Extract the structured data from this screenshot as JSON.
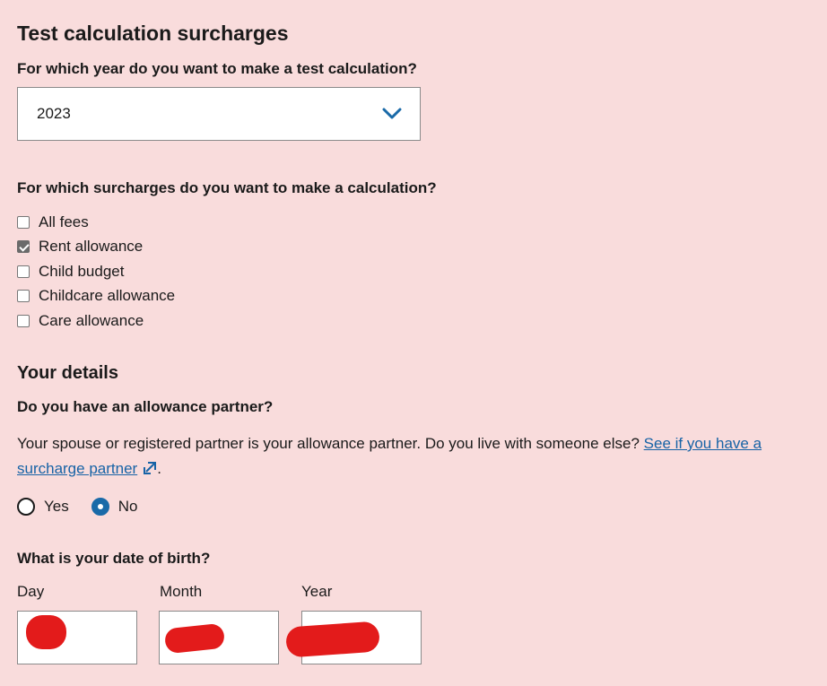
{
  "page": {
    "title": "Test calculation surcharges"
  },
  "year_question": {
    "label": "For which year do you want to make a test calculation?",
    "selected_value": "2023"
  },
  "surcharges_question": {
    "label": "For which surcharges do you want to make a calculation?",
    "options": [
      {
        "label": "All fees",
        "checked": false
      },
      {
        "label": "Rent allowance",
        "checked": true
      },
      {
        "label": "Child budget",
        "checked": false
      },
      {
        "label": "Childcare allowance",
        "checked": false
      },
      {
        "label": "Care allowance",
        "checked": false
      }
    ]
  },
  "details": {
    "heading": "Your details",
    "partner_question": "Do you have an allowance partner?",
    "partner_help": "Your spouse or registered partner is your allowance partner. Do you live with someone else?",
    "partner_link": "See if you have a surcharge partner",
    "partner_suffix": ".",
    "partner_options": [
      {
        "label": "Yes",
        "selected": false
      },
      {
        "label": "No",
        "selected": true
      }
    ],
    "dob_question": "What is your date of birth?",
    "dob_fields": {
      "day_label": "Day",
      "month_label": "Month",
      "year_label": "Year"
    }
  },
  "colors": {
    "background": "#f9dcdc",
    "link": "#1763a6",
    "accent": "#1a6aa8",
    "redaction": "#e31b1b"
  },
  "icons": {
    "select_chevron": "chevron-down-icon",
    "external_link": "external-link-icon"
  }
}
